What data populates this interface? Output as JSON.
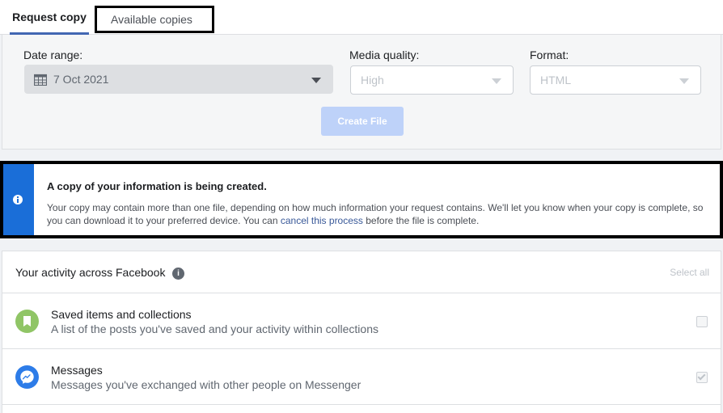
{
  "tabs": {
    "request": "Request copy",
    "available": "Available copies"
  },
  "form": {
    "date_label": "Date range:",
    "date_value": "7 Oct 2021",
    "quality_label": "Media quality:",
    "quality_value": "High",
    "format_label": "Format:",
    "format_value": "HTML",
    "create_label": "Create File"
  },
  "notice": {
    "title": "A copy of your information is being created.",
    "body_1": "Your copy may contain more than one file, depending on how much information your request contains. We'll let you know when your copy is complete, so you can download it to your preferred device. You can ",
    "link": "cancel this process",
    "body_2": " before the file is complete."
  },
  "activity": {
    "title": "Your activity across Facebook",
    "select_all": "Select all",
    "items": [
      {
        "title": "Saved items and collections",
        "desc": "A list of the posts you've saved and your activity within collections",
        "icon": "bookmark-icon",
        "color": "#90c566"
      },
      {
        "title": "Messages",
        "desc": "Messages you've exchanged with other people on Messenger",
        "icon": "messenger-icon",
        "color": "#2d7ce8"
      }
    ]
  },
  "colors": {
    "accent": "#4267b2",
    "notice_bar": "#1a6ed8",
    "button_disabled": "#bed2f9"
  }
}
